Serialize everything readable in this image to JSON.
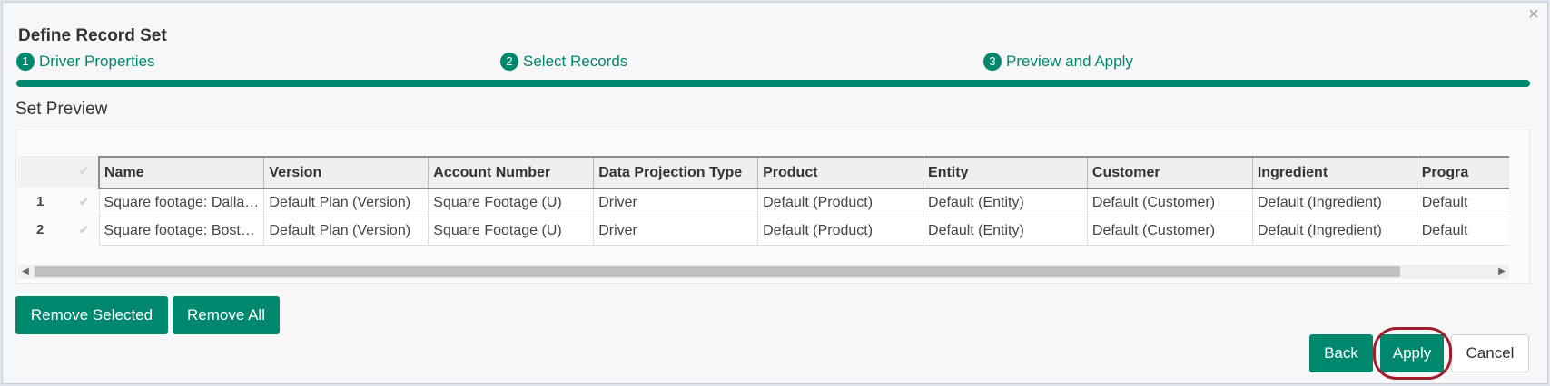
{
  "dialog": {
    "title": "Define Record Set",
    "close_icon": "close-icon"
  },
  "wizard": {
    "steps": [
      {
        "number": "1",
        "label": "Driver Properties"
      },
      {
        "number": "2",
        "label": "Select Records"
      },
      {
        "number": "3",
        "label": "Preview and Apply"
      }
    ],
    "progress_percent": 100,
    "accent_color": "#00886f"
  },
  "preview": {
    "section_title": "Set Preview",
    "columns": [
      "Name",
      "Version",
      "Account Number",
      "Data Projection Type",
      "Product",
      "Entity",
      "Customer",
      "Ingredient",
      "Progra"
    ],
    "rows": [
      {
        "num": "1",
        "cells": [
          "Square footage: Dallas …",
          "Default Plan (Version)",
          "Square Footage (U)",
          "Driver",
          "Default (Product)",
          "Default (Entity)",
          "Default (Customer)",
          "Default (Ingredient)",
          "Default"
        ]
      },
      {
        "num": "2",
        "cells": [
          "Square footage: Bosto…",
          "Default Plan (Version)",
          "Square Footage (U)",
          "Driver",
          "Default (Product)",
          "Default (Entity)",
          "Default (Customer)",
          "Default (Ingredient)",
          "Default"
        ]
      }
    ]
  },
  "actions": {
    "remove_selected": "Remove Selected",
    "remove_all": "Remove All",
    "back": "Back",
    "apply": "Apply",
    "cancel": "Cancel"
  }
}
